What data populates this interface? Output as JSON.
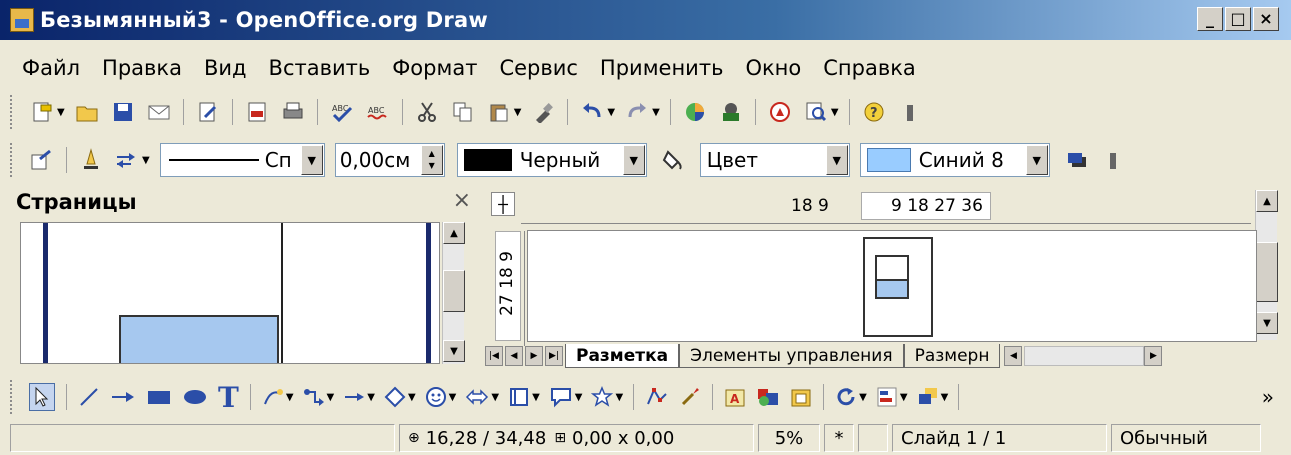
{
  "window": {
    "title": "Безымянный3 - OpenOffice.org Draw",
    "controls": {
      "minimize": "_",
      "maximize": "□",
      "close": "×"
    }
  },
  "menu": [
    "Файл",
    "Правка",
    "Вид",
    "Вставить",
    "Формат",
    "Сервис",
    "Применить",
    "Окно",
    "Справка"
  ],
  "line_toolbar": {
    "line_style": "Сп",
    "line_width": "0,00см",
    "line_color_label": "Черный",
    "line_color": "#000000",
    "area_style": "Цвет",
    "area_color_label": "Синий 8",
    "area_color": "#99ccff"
  },
  "pages_panel": {
    "title": "Страницы",
    "close": "×"
  },
  "ruler": {
    "h_left": "18 9",
    "h_right": "9 18 27 36",
    "v_label": "27 18 9"
  },
  "tabs": [
    "Разметка",
    "Элементы управления",
    "Размерн"
  ],
  "status": {
    "position": "16,28 / 34,48",
    "size": "0,00 x 0,00",
    "zoom": "5%",
    "modified": "*",
    "slide": "Слайд 1 / 1",
    "style": "Обычный"
  },
  "drawbar": {
    "text_tool": "T",
    "more": "»"
  },
  "colors": {
    "accent": "#0a246a",
    "shape_fill": "#a6c8ef"
  }
}
